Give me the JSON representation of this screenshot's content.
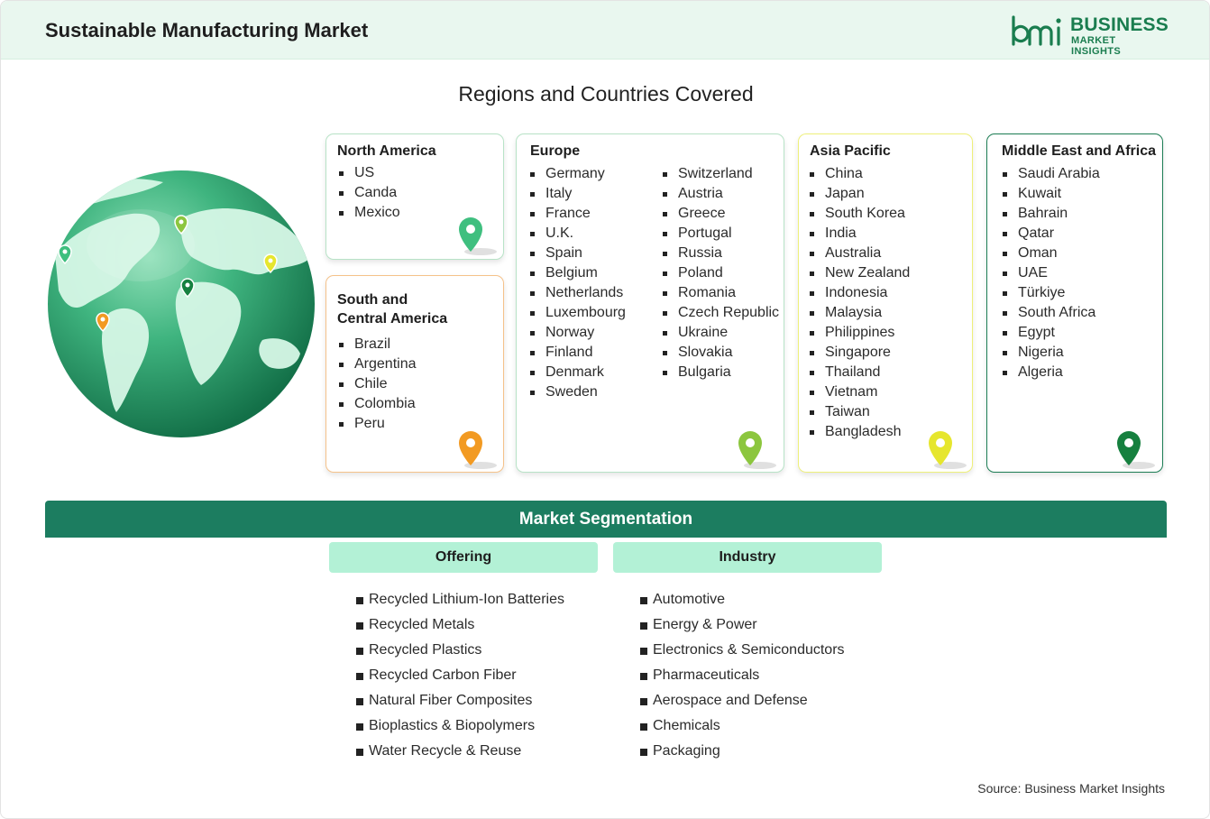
{
  "header": {
    "title": "Sustainable Manufacturing Market",
    "logo_word1": "BUSINESS",
    "logo_word2": "MARKET INSIGHTS"
  },
  "regions": {
    "title": "Regions and Countries Covered",
    "north_america": {
      "title": "North America",
      "items": [
        "US",
        "Canda",
        "Mexico"
      ],
      "pin_color": "#3fbf7f"
    },
    "south_central_america": {
      "title_line1": "South and",
      "title_line2": "Central America",
      "items": [
        "Brazil",
        "Argentina",
        "Chile",
        "Colombia",
        "Peru"
      ],
      "pin_color": "#f29a22"
    },
    "europe": {
      "title": "Europe",
      "col1": [
        "Germany",
        "Italy",
        "France",
        "U.K.",
        "Spain",
        "Belgium",
        "Netherlands",
        "Luxembourg",
        "Norway",
        "Finland",
        "Denmark",
        "Sweden"
      ],
      "col2": [
        "Switzerland",
        "Austria",
        "Greece",
        "Portugal",
        "Russia",
        "Poland",
        "Romania",
        "Czech Republic",
        "Ukraine",
        "Slovakia",
        "Bulgaria"
      ],
      "pin_color": "#8cc63e"
    },
    "asia_pacific": {
      "title": "Asia Pacific",
      "items": [
        "China",
        "Japan",
        "South Korea",
        "India",
        "Australia",
        "New Zealand",
        "Indonesia",
        "Malaysia",
        "Philippines",
        "Singapore",
        "Thailand",
        "Vietnam",
        "Taiwan",
        "Bangladesh"
      ],
      "pin_color": "#e6e62e"
    },
    "mea": {
      "title": "Middle East and Africa",
      "items": [
        "Saudi Arabia",
        "Kuwait",
        "Bahrain",
        "Qatar",
        "Oman",
        "UAE",
        "Türkiye",
        "South Africa",
        "Egypt",
        "Nigeria",
        "Algeria"
      ],
      "pin_color": "#16803f"
    }
  },
  "segmentation": {
    "title": "Market Segmentation",
    "offering": {
      "title": "Offering",
      "items": [
        "Recycled Lithium-Ion Batteries",
        "Recycled Metals",
        "Recycled Plastics",
        "Recycled Carbon Fiber",
        "Natural Fiber Composites",
        "Bioplastics & Biopolymers",
        "Water Recycle & Reuse"
      ]
    },
    "industry": {
      "title": "Industry",
      "items": [
        "Automotive",
        "Energy & Power",
        "Electronics & Semiconductors",
        "Pharmaceuticals",
        "Aerospace and Defense",
        "Chemicals",
        "Packaging"
      ]
    }
  },
  "source": "Source: Business Market Insights"
}
